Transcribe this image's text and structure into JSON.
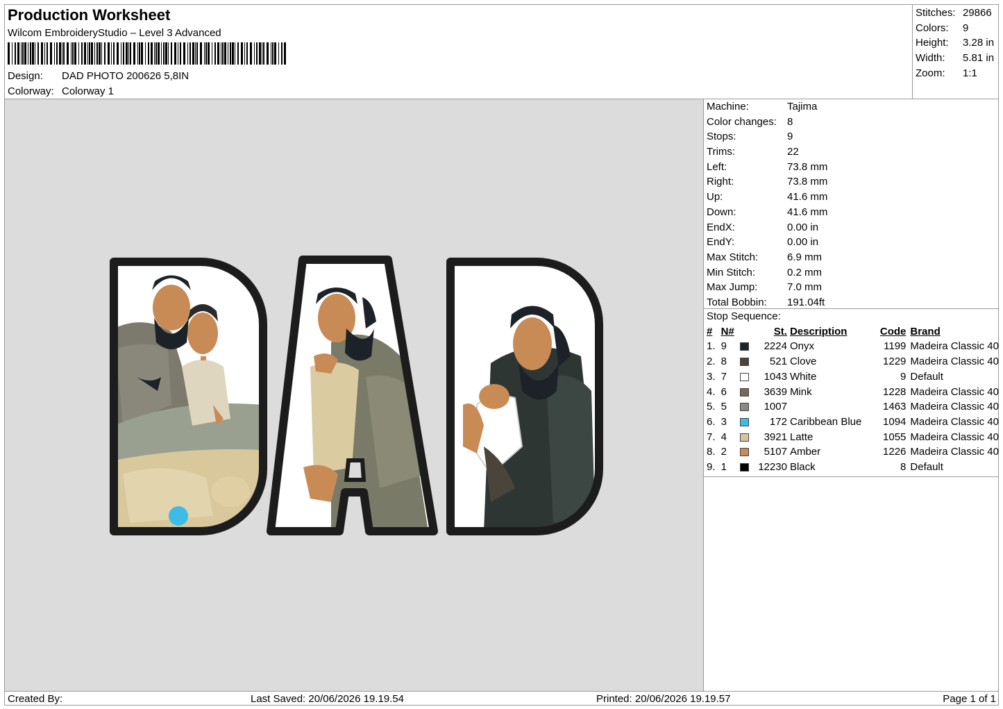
{
  "header": {
    "title": "Production Worksheet",
    "software": "Wilcom EmbroideryStudio – Level 3 Advanced",
    "design_label": "Design:",
    "design_value": "DAD PHOTO 200626 5,8IN",
    "colorway_label": "Colorway:",
    "colorway_value": "Colorway 1"
  },
  "stats": [
    {
      "label": "Stitches:",
      "value": "29866"
    },
    {
      "label": "Colors:",
      "value": "9"
    },
    {
      "label": "Height:",
      "value": "3.28 in"
    },
    {
      "label": "Width:",
      "value": "5.81 in"
    },
    {
      "label": "Zoom:",
      "value": "1:1"
    }
  ],
  "machine_info": [
    {
      "label": "Machine:",
      "value": "Tajima"
    },
    {
      "label": "Color changes:",
      "value": "8"
    },
    {
      "label": "Stops:",
      "value": "9"
    },
    {
      "label": "Trims:",
      "value": "22"
    },
    {
      "label": "Left:",
      "value": "73.8 mm"
    },
    {
      "label": "Right:",
      "value": "73.8 mm"
    },
    {
      "label": "Up:",
      "value": "41.6 mm"
    },
    {
      "label": "Down:",
      "value": "41.6 mm"
    },
    {
      "label": "EndX:",
      "value": "0.00 in"
    },
    {
      "label": "EndY:",
      "value": "0.00 in"
    },
    {
      "label": "Max Stitch:",
      "value": "6.9 mm"
    },
    {
      "label": "Min Stitch:",
      "value": "0.2 mm"
    },
    {
      "label": "Max Jump:",
      "value": "7.0 mm"
    },
    {
      "label": "Total Bobbin:",
      "value": "191.04ft"
    }
  ],
  "stop_sequence": {
    "title": "Stop Sequence:",
    "headers": {
      "idx": "#",
      "n": "N#",
      "st": "St.",
      "desc": "Description",
      "code": "Code",
      "brand": "Brand"
    },
    "rows": [
      {
        "idx": "1.",
        "n": "9",
        "color": "#1c2228",
        "st": "2224",
        "desc": "Onyx",
        "code": "1199",
        "brand": "Madeira Classic 40"
      },
      {
        "idx": "2.",
        "n": "8",
        "color": "#4a443a",
        "st": "521",
        "desc": "Clove",
        "code": "1229",
        "brand": "Madeira Classic 40"
      },
      {
        "idx": "3.",
        "n": "7",
        "color": "#ffffff",
        "st": "1043",
        "desc": "White",
        "code": "9",
        "brand": "Default"
      },
      {
        "idx": "4.",
        "n": "6",
        "color": "#736a5c",
        "st": "3639",
        "desc": "Mink",
        "code": "1228",
        "brand": "Madeira Classic 40"
      },
      {
        "idx": "5.",
        "n": "5",
        "color": "#8a8a84",
        "st": "1007",
        "desc": "",
        "code": "1463",
        "brand": "Madeira Classic 40"
      },
      {
        "idx": "6.",
        "n": "3",
        "color": "#3bbde6",
        "st": "172",
        "desc": "Caribbean Blue",
        "code": "1094",
        "brand": "Madeira Classic 40"
      },
      {
        "idx": "7.",
        "n": "4",
        "color": "#d9c39c",
        "st": "3921",
        "desc": "Latte",
        "code": "1055",
        "brand": "Madeira Classic 40"
      },
      {
        "idx": "8.",
        "n": "2",
        "color": "#c98b55",
        "st": "5107",
        "desc": "Amber",
        "code": "1226",
        "brand": "Madeira Classic 40"
      },
      {
        "idx": "9.",
        "n": "1",
        "color": "#000000",
        "st": "12230",
        "desc": "Black",
        "code": "8",
        "brand": "Default"
      }
    ]
  },
  "footer": {
    "created_by": "Created By:",
    "last_saved": "Last Saved: 20/06/2026 19.19.54",
    "printed": "Printed: 20/06/2026 19.19.57",
    "page": "Page 1 of 1"
  }
}
